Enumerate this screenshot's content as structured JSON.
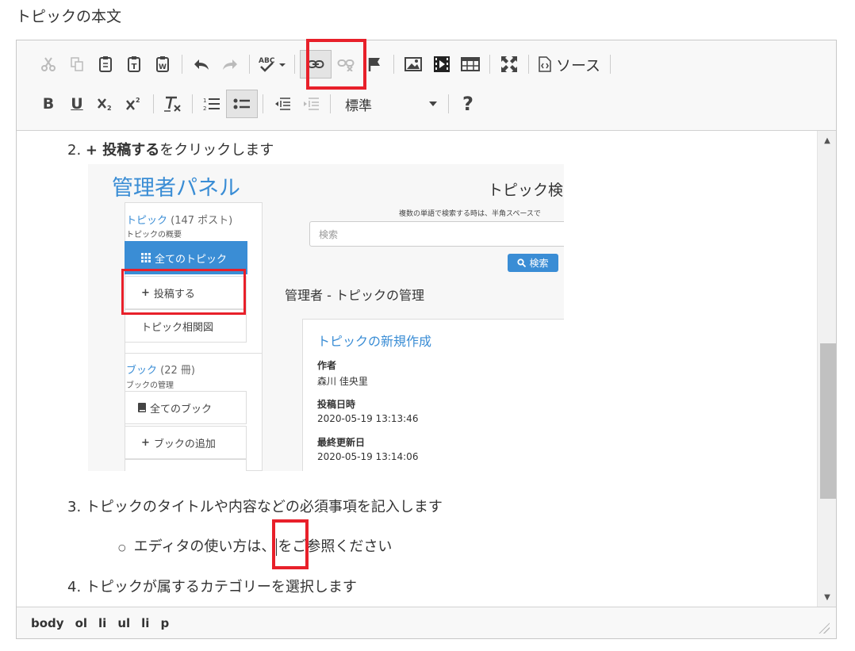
{
  "field_label": "トピックの本文",
  "toolbar": {
    "row1": [
      {
        "name": "cut-icon",
        "glyph": "✂",
        "disabled": true
      },
      {
        "name": "copy-icon",
        "glyph": "⧉",
        "disabled": true
      },
      {
        "name": "paste-icon",
        "glyph": "📋"
      },
      {
        "name": "paste-text-icon",
        "glyph": "T"
      },
      {
        "name": "paste-word-icon",
        "glyph": "W"
      },
      {
        "name": "undo-icon",
        "glyph": "↶"
      },
      {
        "name": "redo-icon",
        "glyph": "↷",
        "disabled": true
      },
      {
        "name": "spellcheck-icon",
        "glyph": "ABC✓"
      },
      {
        "name": "link-icon",
        "glyph": "🔗",
        "active": true
      },
      {
        "name": "unlink-icon",
        "glyph": "⛓",
        "disabled": true
      },
      {
        "name": "anchor-flag-icon",
        "glyph": "⚑"
      },
      {
        "name": "image-icon",
        "glyph": "🖼"
      },
      {
        "name": "video-icon",
        "glyph": "🎞"
      },
      {
        "name": "table-icon",
        "glyph": "▦"
      },
      {
        "name": "maximize-icon",
        "glyph": "⤢"
      }
    ],
    "source_label": "ソース",
    "format_value": "標準",
    "help_glyph": "?"
  },
  "content": {
    "step2_number": "2.",
    "step2_bold": "+ 投稿する",
    "step2_rest": "をクリックします",
    "step3_number": "3.",
    "step3_text": "トピックのタイトルや内容などの必須事項を記入します",
    "substep_before": "エディタの使い方は、",
    "substep_after": "をご参照ください",
    "step4_number": "4.",
    "step4_text": "トピックが属するカテゴリーを選択します"
  },
  "screenshot": {
    "admin_title": "管理者パネル",
    "topics_label": "トピック",
    "topics_count": "(147 ポスト)",
    "topics_sub": "トピックの概要",
    "all_topics": "全てのトピック",
    "post": "投稿する",
    "topic_map": "トピック相関図",
    "books_label": "ブック",
    "books_count": "(22 冊)",
    "books_sub": "ブックの管理",
    "all_books": "全てのブック",
    "add_book": "ブックの追加",
    "search_title": "トピック検",
    "search_hint": "複数の単語で検索する時は、半角スペースで",
    "search_placeholder": "検索",
    "search_button": "検索",
    "manage_title": "管理者 - トピックの管理",
    "card_title": "トピックの新規作成",
    "author_label": "作者",
    "author_value": "森川 佳央里",
    "posted_label": "投稿日時",
    "posted_value": "2020-05-19 13:13:46",
    "updated_label": "最終更新日",
    "updated_value": "2020-05-19 13:14:06"
  },
  "statusbar": [
    "body",
    "ol",
    "li",
    "ul",
    "li",
    "p"
  ],
  "colors": {
    "highlight": "#e8202a",
    "accent": "#3a8dd5"
  }
}
